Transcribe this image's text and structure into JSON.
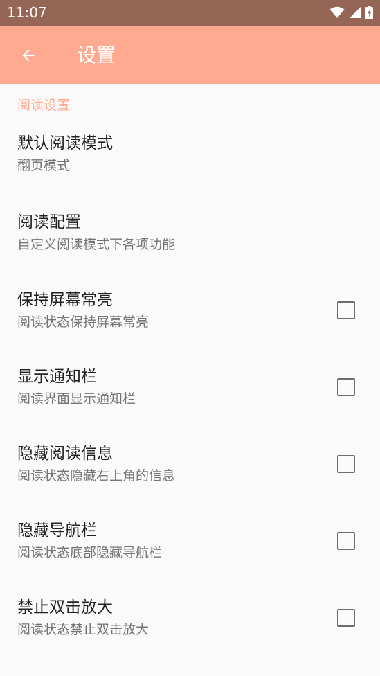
{
  "status_bar": {
    "time": "11:07"
  },
  "app_bar": {
    "title": "设置",
    "back_icon": "arrow-back-icon"
  },
  "section": {
    "title": "阅读设置"
  },
  "items": [
    {
      "title": "默认阅读模式",
      "summary": "翻页模式",
      "has_checkbox": false
    },
    {
      "title": "阅读配置",
      "summary": "自定义阅读模式下各项功能",
      "has_checkbox": false
    },
    {
      "title": "保持屏幕常亮",
      "summary": "阅读状态保持屏幕常亮",
      "has_checkbox": true,
      "checked": false
    },
    {
      "title": "显示通知栏",
      "summary": "阅读界面显示通知栏",
      "has_checkbox": true,
      "checked": false
    },
    {
      "title": "隐藏阅读信息",
      "summary": "阅读状态隐藏右上角的信息",
      "has_checkbox": true,
      "checked": false
    },
    {
      "title": "隐藏导航栏",
      "summary": "阅读状态底部隐藏导航栏",
      "has_checkbox": true,
      "checked": false
    },
    {
      "title": "禁止双击放大",
      "summary": "阅读状态禁止双击放大",
      "has_checkbox": true,
      "checked": false
    }
  ],
  "colors": {
    "status_bar": "#956656",
    "app_bar": "#ffaa90",
    "accent": "#ffaa90",
    "background": "#fafafa"
  }
}
